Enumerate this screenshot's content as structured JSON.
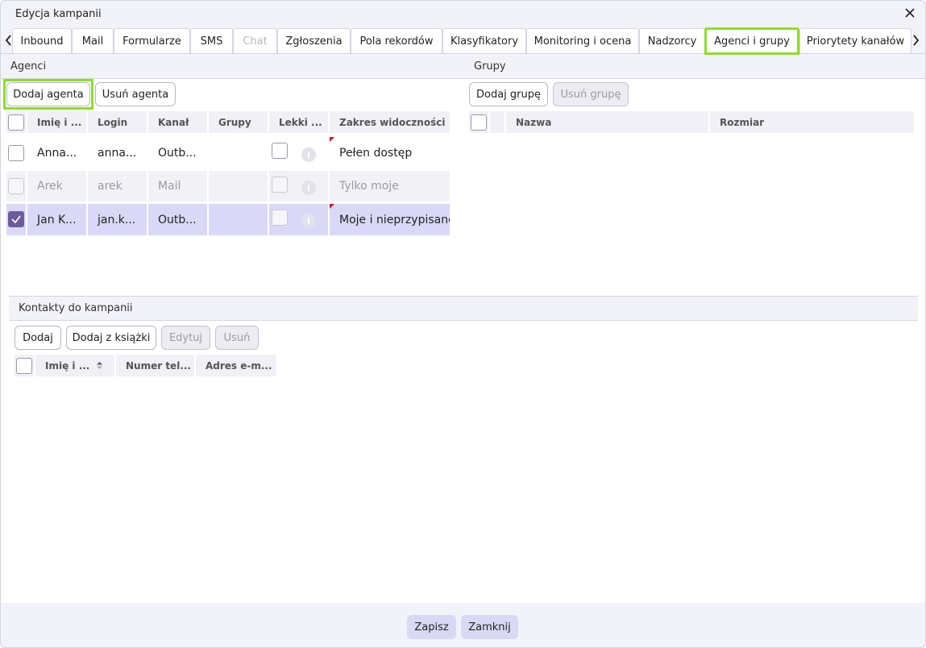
{
  "window": {
    "title": "Edycja kampanii"
  },
  "tabs": [
    {
      "label": "Inbound"
    },
    {
      "label": "Mail"
    },
    {
      "label": "Formularze"
    },
    {
      "label": "SMS"
    },
    {
      "label": "Chat"
    },
    {
      "label": "Zgłoszenia"
    },
    {
      "label": "Pola rekordów"
    },
    {
      "label": "Klasyfikatory"
    },
    {
      "label": "Monitoring i ocena"
    },
    {
      "label": "Nadzorcy"
    },
    {
      "label": "Agenci i grupy"
    },
    {
      "label": "Priorytety kanałów"
    }
  ],
  "active_tab": "Agenci i grupy",
  "agents": {
    "header": "Agenci",
    "add_button": "Dodaj agenta",
    "remove_button": "Usuń agenta",
    "columns": [
      "Imię i ...",
      "Login",
      "Kanał",
      "Grupy",
      "Lekki ...",
      "Zakres widoczności"
    ],
    "rows": [
      {
        "name": "Anna...",
        "login": "anna...",
        "channel": "Outb...",
        "groups": "",
        "visibility": "Pełen dostęp",
        "checked": false,
        "state": "normal"
      },
      {
        "name": "Arek",
        "login": "arek",
        "channel": "Mail",
        "groups": "",
        "visibility": "Tylko moje",
        "checked": false,
        "state": "disabled"
      },
      {
        "name": "Jan K...",
        "login": "jan.k...",
        "channel": "Outb...",
        "groups": "",
        "visibility": "Moje i nieprzypisane",
        "checked": true,
        "state": "selected"
      }
    ]
  },
  "groups": {
    "header": "Grupy",
    "add_button": "Dodaj grupę",
    "remove_button": "Usuń grupę",
    "columns": [
      "Nazwa",
      "Rozmiar"
    ]
  },
  "contacts": {
    "header": "Kontakty do kampanii",
    "add_button": "Dodaj",
    "add_from_book_button": "Dodaj z książki",
    "edit_button": "Edytuj",
    "remove_button": "Usuń",
    "columns": [
      "Imię i ...",
      "Numer tel...",
      "Adres e-m..."
    ]
  },
  "footer": {
    "save_label": "Zapisz",
    "close_label": "Zamknij"
  },
  "colors": {
    "highlight": "#8edc2a",
    "accent": "#6e5a9a",
    "selected_row": "#d9d9f7",
    "panel": "#f2f2f9"
  }
}
